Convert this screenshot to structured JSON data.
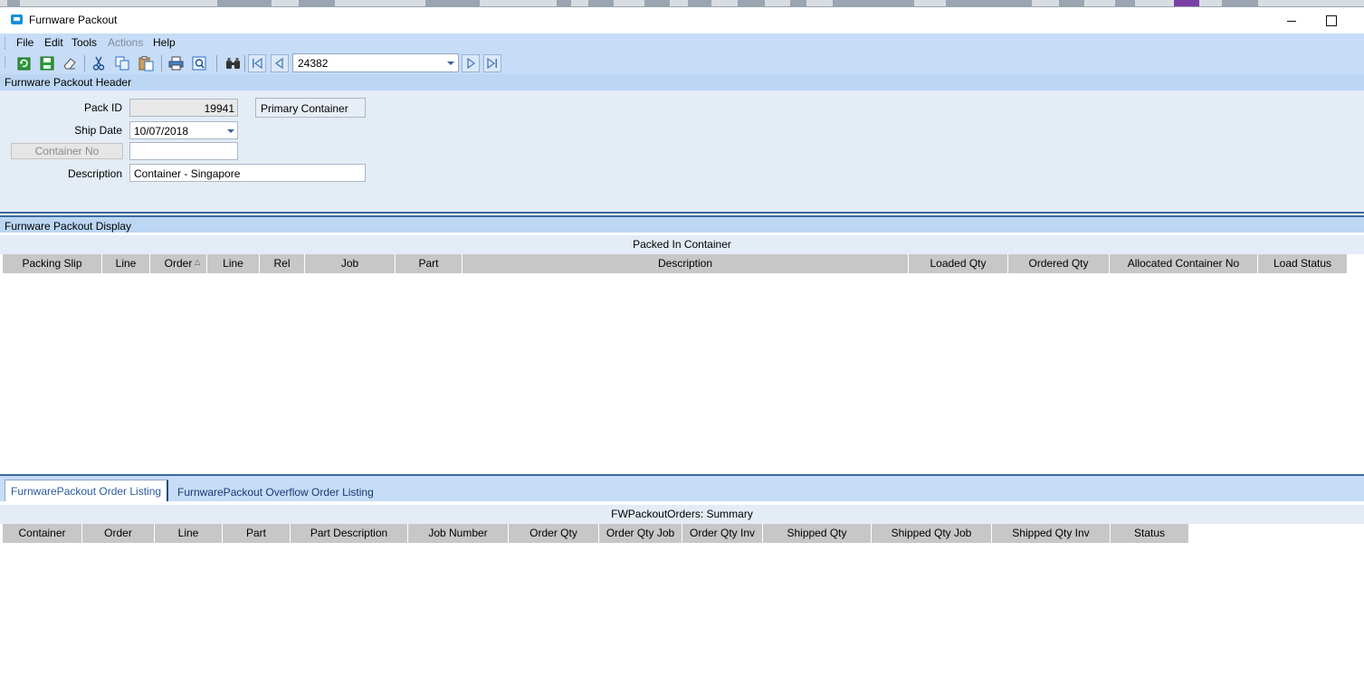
{
  "window": {
    "title": "Furnware Packout",
    "minimize_label": "",
    "maximize_label": ""
  },
  "menu": {
    "items": [
      "File",
      "Edit",
      "Tools",
      "Actions",
      "Help"
    ]
  },
  "toolbar": {
    "record_combo_value": "24382",
    "icons": [
      "refresh-icon",
      "save-icon",
      "clear-icon",
      "cut-icon",
      "copy-icon",
      "paste-icon",
      "print-icon",
      "print-preview-icon",
      "search-icon",
      "first-record-icon",
      "previous-record-icon",
      "next-record-icon",
      "last-record-icon"
    ]
  },
  "header_panel": {
    "title": "Furnware Packout Header",
    "pack_id_label": "Pack ID",
    "pack_id_value": "19941",
    "primary_container_label": "Primary Container",
    "ship_date_label": "Ship Date",
    "ship_date_value": "10/07/2018",
    "container_no_label": "Container No",
    "container_no_value": "",
    "description_label": "Description",
    "description_value": "Container - Singapore"
  },
  "display_panel": {
    "title": "Furnware Packout Display",
    "grid_caption": "Packed In Container",
    "columns": [
      "Packing Slip",
      "Line",
      "Order",
      "Line",
      "Rel",
      "Job",
      "Part",
      "Description",
      "Loaded Qty",
      "Ordered Qty",
      "Allocated Container No",
      "Load Status"
    ]
  },
  "tabs": {
    "items": [
      "FurnwarePackout Order Listing",
      "FurnwarePackout Overflow Order Listing"
    ],
    "active_index": 0
  },
  "orders_panel": {
    "grid_caption": "FWPackoutOrders: Summary",
    "columns": [
      "Container",
      "Order",
      "Line",
      "Part",
      "Part Description",
      "Job Number",
      "Order Qty",
      "Order Qty Job",
      "Order Qty Inv",
      "Shipped Qty",
      "Shipped Qty Job",
      "Shipped Qty Inv",
      "Status"
    ]
  },
  "colors": {
    "menu_band": "#c6dcf7",
    "panel_band": "#bcd6f4",
    "panel_body": "#e4ecf6",
    "grid_header": "#c7c7c7",
    "separator": "#3b6a9c"
  }
}
